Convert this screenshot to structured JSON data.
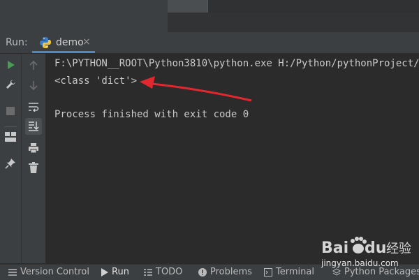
{
  "run_header": {
    "title": "Run:",
    "tab_label": "demo"
  },
  "console": {
    "lines": [
      "F:\\PYTHON__ROOT\\Python3810\\python.exe H:/Python/pythonProject/",
      "<class 'dict'>",
      "",
      "Process finished with exit code 0"
    ]
  },
  "bottom_bar": {
    "items": [
      "Version Control",
      "Run",
      "TODO",
      "Problems",
      "Terminal",
      "Python Packages"
    ]
  },
  "watermark": {
    "brand": "Baidu",
    "brand_cn": "经验",
    "url": "jingyan.baidu.com"
  },
  "colors": {
    "accent": "#4a88c7",
    "run_green": "#499c54",
    "arrow_red": "#e0282e"
  },
  "icons": [
    "python-icon",
    "run-icon",
    "wrench-icon",
    "stop-icon",
    "layout-icon",
    "pin-icon",
    "up-arrow-icon",
    "down-arrow-icon",
    "soft-wrap-icon",
    "scroll-to-end-icon",
    "print-icon",
    "trash-icon",
    "list-icon",
    "play-icon",
    "checklist-icon",
    "warning-icon",
    "terminal-icon",
    "layers-icon"
  ]
}
